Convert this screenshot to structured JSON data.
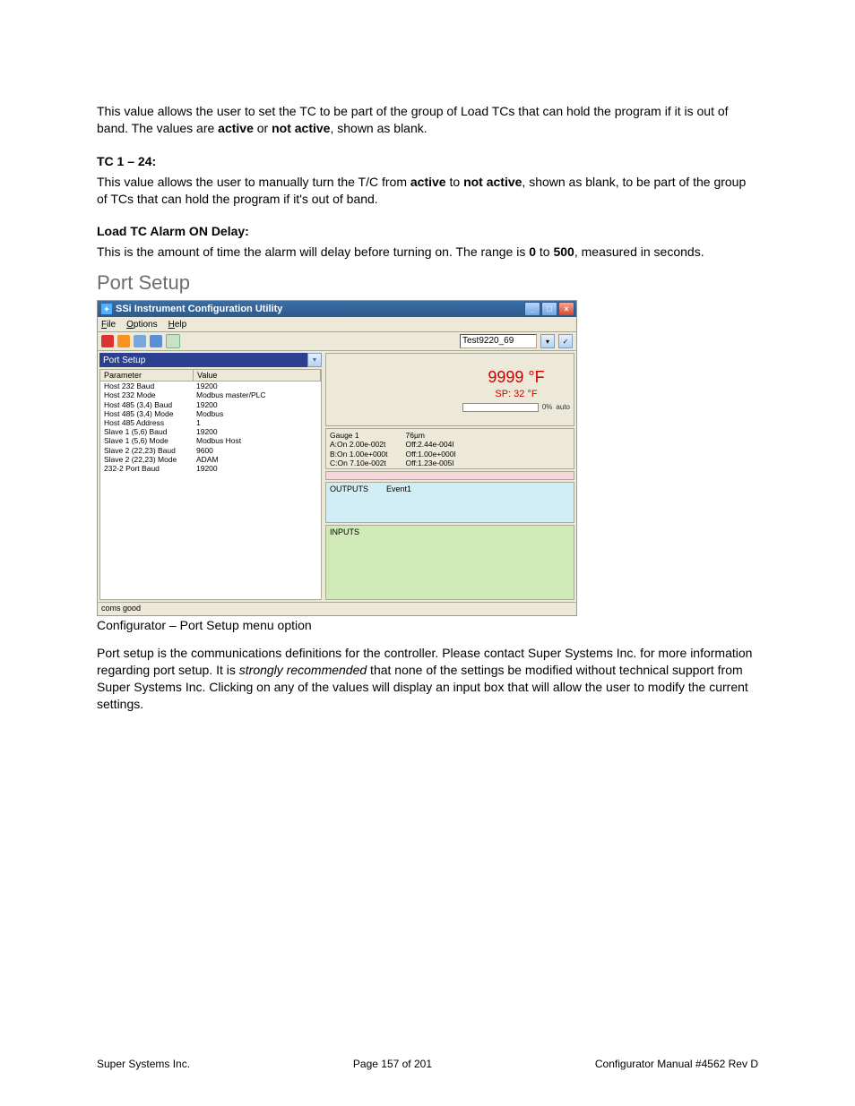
{
  "para1": "This value allows the user to set the TC to be part of the group of Load TCs that can hold the program if it is out of band.  The values are ",
  "para1_b1": "active",
  "para1_mid": " or ",
  "para1_b2": "not active",
  "para1_end": ", shown as blank.",
  "heading_tc": "TC 1 – 24:",
  "para2a": "This value allows the user to manually turn the T/C from ",
  "para2b": " to ",
  "para2c": ", shown as blank, to be part of the group of TCs that can hold the program if it's out of band.",
  "heading_load": "Load TC Alarm ON Delay:",
  "para3a": "This is the amount of time the alarm will delay before turning on.  The range is ",
  "para3b": " to ",
  "para3c": ", measured in seconds.",
  "range_low": "0",
  "range_high": "500",
  "section_title": "Port Setup",
  "app_title": "SSi Instrument Configuration Utility",
  "menus": {
    "file": "File",
    "options": "Options",
    "help": "Help"
  },
  "instrument_id": "Test9220_69",
  "dropdown_label": "Port Setup",
  "columns": {
    "param": "Parameter",
    "value": "Value"
  },
  "rows": [
    {
      "param": "Host 232 Baud",
      "value": "19200"
    },
    {
      "param": "Host 232 Mode",
      "value": "Modbus master/PLC"
    },
    {
      "param": "Host 485 (3,4) Baud",
      "value": "19200"
    },
    {
      "param": "Host 485 (3,4) Mode",
      "value": "Modbus"
    },
    {
      "param": "Host 485 Address",
      "value": "1"
    },
    {
      "param": "Slave 1 (5,6) Baud",
      "value": "19200"
    },
    {
      "param": "Slave 1 (5,6) Mode",
      "value": "Modbus Host"
    },
    {
      "param": "Slave 2 (22,23) Baud",
      "value": "9600"
    },
    {
      "param": "Slave 2 (22,23) Mode",
      "value": "ADAM"
    },
    {
      "param": "232-2 Port Baud",
      "value": "19200"
    }
  ],
  "readout_main": "9999 °F",
  "readout_sp": "SP: 32 °F",
  "readout_pct": "0%",
  "readout_mode": "auto",
  "gauge": {
    "title": "Gauge 1",
    "left": [
      "A:On 2.00e-002t",
      "B:On 1.00e+000t",
      "C:On 7.10e-002t"
    ],
    "right_top": "76µm",
    "right": [
      "Off:2.44e-004l",
      "Off:1.00e+000l",
      "Off:1.23e-005l"
    ]
  },
  "outputs_label": "OUTPUTS",
  "outputs_event": "Event1",
  "inputs_label": "INPUTS",
  "status": "coms good",
  "caption": "Configurator – Port Setup menu option",
  "para4a": "Port setup is the communications definitions for the controller.  Please contact Super Systems Inc. for more information regarding port setup.  It is ",
  "para4_em": "strongly recommended",
  "para4b": " that none of the settings be modified without technical support from Super Systems Inc.  Clicking on any of the values will display an input box that will allow the user to modify the current settings.",
  "footer_left": "Super Systems Inc.",
  "footer_center": "Page 157 of 201",
  "footer_right": "Configurator Manual #4562 Rev D"
}
